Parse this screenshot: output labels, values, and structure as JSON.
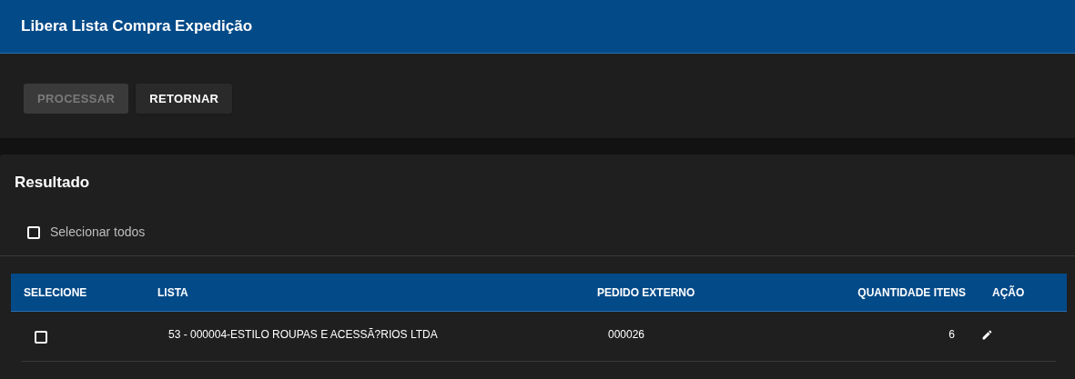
{
  "header": {
    "title": "Libera Lista Compra Expedição"
  },
  "actions": [
    {
      "label": "PROCESSAR",
      "disabled": true
    },
    {
      "label": "RETORNAR",
      "disabled": false
    }
  ],
  "result": {
    "title": "Resultado",
    "select_all": {
      "label": "Selecionar todos",
      "checked": false
    },
    "table": {
      "columns": [
        "SELECIONE",
        "LISTA",
        "PEDIDO EXTERNO",
        "QUANTIDADE ITENS",
        "AÇÃO"
      ],
      "rows": [
        {
          "checked": false,
          "lista": "53 - 000004-ESTILO ROUPAS E ACESSÃ?RIOS LTDA",
          "pedido_externo": "000026",
          "quantidade_itens": "6"
        }
      ]
    }
  }
}
